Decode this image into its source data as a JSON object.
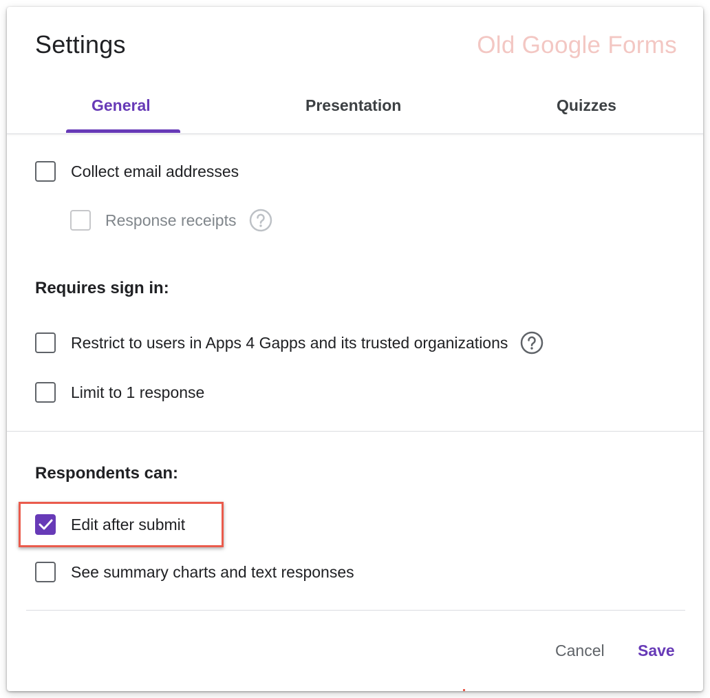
{
  "dialog": {
    "title": "Settings",
    "watermark": "Old Google Forms"
  },
  "tabs": [
    {
      "label": "General",
      "active": true
    },
    {
      "label": "Presentation",
      "active": false
    },
    {
      "label": "Quizzes",
      "active": false
    }
  ],
  "options": {
    "collect_email": {
      "label": "Collect email addresses",
      "checked": false
    },
    "response_receipts": {
      "label": "Response receipts",
      "checked": false,
      "disabled": true
    },
    "requires_sign_in_heading": "Requires sign in:",
    "restrict_users": {
      "label": "Restrict to users in Apps 4 Gapps and its trusted organizations",
      "checked": false
    },
    "limit_one": {
      "label": "Limit to 1 response",
      "checked": false
    },
    "respondents_heading": "Respondents can:",
    "edit_after_submit": {
      "label": "Edit after submit",
      "checked": true
    },
    "see_summary": {
      "label": "See summary charts and text responses",
      "checked": false
    }
  },
  "footer": {
    "cancel_label": "Cancel",
    "save_label": "Save"
  },
  "colors": {
    "accent": "#673ab7",
    "highlight": "#ea5b4c",
    "watermark": "#f3c7c3"
  },
  "icons": [
    "help-circle-icon",
    "checkmark-icon"
  ]
}
